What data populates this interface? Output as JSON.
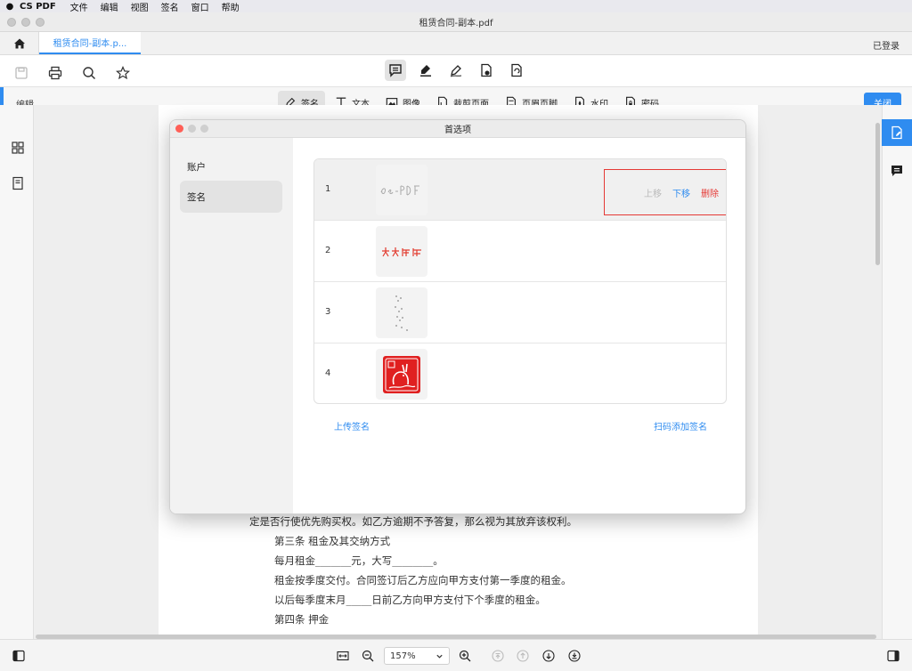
{
  "menubar": {
    "app_name": "CS PDF",
    "menus": [
      "文件",
      "编辑",
      "视图",
      "签名",
      "窗口",
      "帮助"
    ]
  },
  "window": {
    "title": "租赁合同-副本.pdf"
  },
  "tabbar": {
    "active_tab": "租赁合同-副本.p...",
    "login_status": "已登录"
  },
  "editbar": {
    "mode_label": "编辑",
    "tools": [
      {
        "label": "签名",
        "icon": "pen-signature-icon",
        "active": true
      },
      {
        "label": "文本",
        "icon": "text-t-icon",
        "active": false
      },
      {
        "label": "图像",
        "icon": "image-icon",
        "active": false
      },
      {
        "label": "裁剪页面",
        "icon": "crop-page-icon",
        "active": false
      },
      {
        "label": "页眉页脚",
        "icon": "header-footer-icon",
        "active": false
      },
      {
        "label": "水印",
        "icon": "watermark-icon",
        "active": false
      },
      {
        "label": "密码",
        "icon": "lock-file-icon",
        "active": false
      }
    ],
    "close_label": "关闭"
  },
  "document": {
    "lines": [
      "定是否行使优先购买权。如乙方逾期不予答复，那么视为其放弃该权利。",
      "第三条  租金及其交纳方式",
      "每月租金_______元，大写________。",
      "租金按季度交付。合同签订后乙方应向甲方支付第一季度的租金。",
      "以后每季度末月_____日前乙方向甲方支付下个季度的租金。",
      "第四条  押金"
    ]
  },
  "statusbar": {
    "zoom": "157%"
  },
  "dialog": {
    "title": "首选项",
    "sidebar": [
      {
        "label": "账户",
        "active": false
      },
      {
        "label": "签名",
        "active": true
      }
    ],
    "signatures": [
      {
        "index": "1",
        "kind": "handwritten-latin"
      },
      {
        "index": "2",
        "kind": "handwritten-red"
      },
      {
        "index": "3",
        "kind": "dotted-vertical"
      },
      {
        "index": "4",
        "kind": "red-seal"
      }
    ],
    "row_actions": {
      "move_up": "上移",
      "move_down": "下移",
      "delete": "删除"
    },
    "upload_label": "上传签名",
    "scan_label": "扫码添加签名"
  },
  "colors": {
    "accent": "#2f8cf0",
    "danger": "#e53935",
    "disabled": "#b9b9b9"
  }
}
